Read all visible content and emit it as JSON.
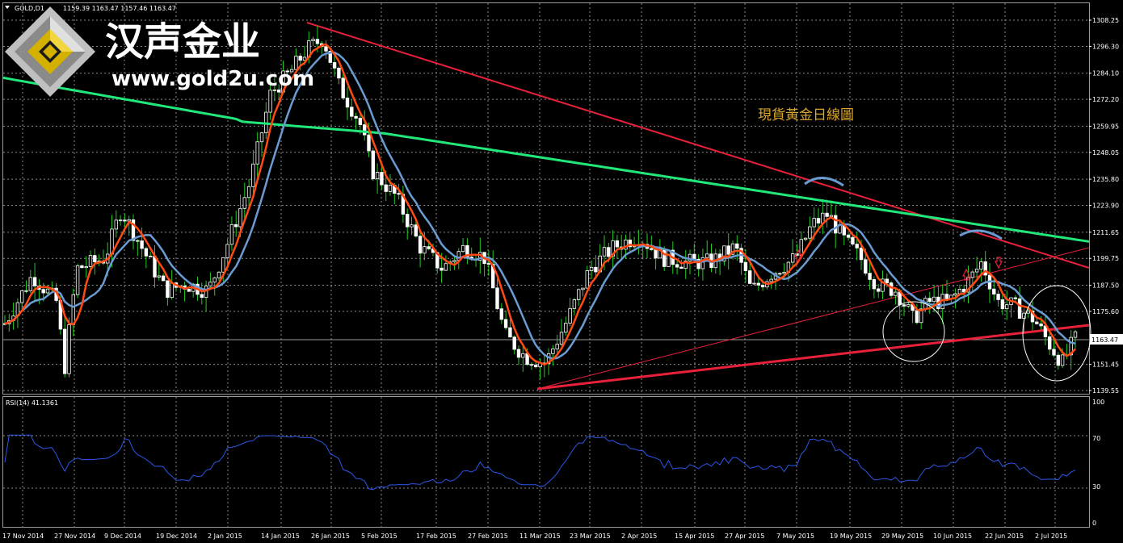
{
  "header": {
    "symbol": "GOLD,D1",
    "ohlc": "1159.39 1163.47 1157.46 1163.47"
  },
  "logo": {
    "name_cn": "汉声金业",
    "url": "www.gold2u.com"
  },
  "annotation": "現貨黃金日線圖",
  "price_axis": {
    "ticks": [
      "1308.25",
      "1296.30",
      "1284.10",
      "1272.20",
      "1259.95",
      "1248.05",
      "1235.80",
      "1223.90",
      "1211.65",
      "1199.75",
      "1187.50",
      "1175.60",
      "1163.47",
      "1151.45",
      "1139.55"
    ],
    "current": "1163.47"
  },
  "rsi": {
    "label": "RSI(14) 41.1361",
    "ticks": [
      "100",
      "70",
      "30",
      "0"
    ]
  },
  "date_axis": {
    "labels": [
      "17 Nov 2014",
      "27 Nov 2014",
      "9 Dec 2014",
      "19 Dec 2014",
      "2 Jan 2015",
      "14 Jan 2015",
      "26 Jan 2015",
      "5 Feb 2015",
      "17 Feb 2015",
      "27 Feb 2015",
      "11 Mar 2015",
      "23 Mar 2015",
      "2 Apr 2015",
      "15 Apr 2015",
      "27 Apr 2015",
      "7 May 2015",
      "19 May 2015",
      "29 May 2015",
      "10 Jun 2015",
      "22 Jun 2015",
      "2 Jul 2015"
    ]
  },
  "colors": {
    "background": "#000000",
    "bull_candle": "#ffffff",
    "bear_candle": "#ffffff",
    "candle_wick": "#22cc22",
    "ma_fast": "#ff4a14",
    "ma_mid": "#6a9bd1",
    "ma_long": "#21e87a",
    "trendline": "#e8203a",
    "rsi_line": "#2c56e8",
    "grid": "#8a8a8a",
    "annotation": "#d9a62a"
  },
  "chart_data": {
    "type": "candlestick",
    "title": "現貨黃金日線圖",
    "price_ylim": [
      1135,
      1315
    ],
    "rsi_ylim": [
      0,
      100
    ],
    "grid": true,
    "series": [
      {
        "name": "price",
        "x": [
          "17 Nov 2014",
          "27 Nov 2014",
          "9 Dec 2014",
          "19 Dec 2014",
          "2 Jan 2015",
          "14 Jan 2015",
          "26 Jan 2015",
          "5 Feb 2015",
          "17 Feb 2015",
          "27 Feb 2015",
          "11 Mar 2015",
          "23 Mar 2015",
          "2 Apr 2015",
          "15 Apr 2015",
          "27 Apr 2015",
          "7 May 2015",
          "19 May 2015",
          "29 May 2015",
          "10 Jun 2015",
          "22 Jun 2015",
          "2 Jul 2015"
        ],
        "close": [
          1175,
          1193,
          1222,
          1195,
          1190,
          1268,
          1300,
          1235,
          1207,
          1200,
          1155,
          1195,
          1205,
          1195,
          1188,
          1195,
          1205,
          1190,
          1180,
          1185,
          1163.47
        ]
      },
      {
        "name": "RSI(14)",
        "values": [
          58,
          54,
          62,
          55,
          56,
          66,
          75,
          48,
          45,
          42,
          28,
          54,
          55,
          52,
          50,
          58,
          52,
          46,
          50,
          48,
          41.1361
        ]
      }
    ]
  }
}
